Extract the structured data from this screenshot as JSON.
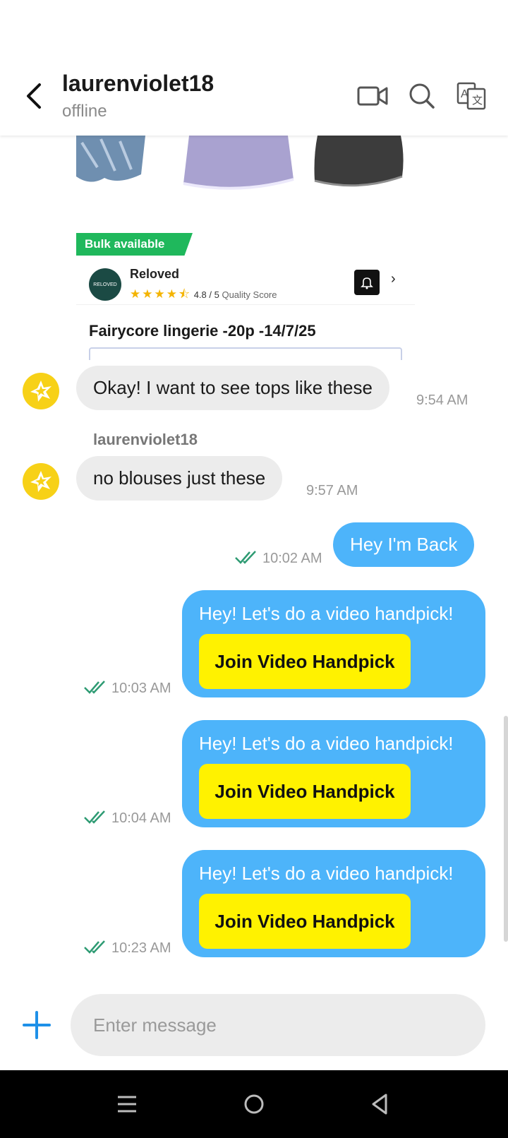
{
  "header": {
    "contact_name": "laurenviolet18",
    "status": "offline",
    "icons": [
      "back-arrow-icon",
      "video-call-icon",
      "search-icon",
      "translate-icon"
    ]
  },
  "product_card": {
    "bulk_tag": "Bulk available",
    "seller_name": "Reloved",
    "seller_logo_text": "RELOVED",
    "rating": "4.8 / 5",
    "rating_label": "Quality Score",
    "title": "Fairycore lingerie -20p -14/7/25"
  },
  "messages": {
    "m1_text": "Okay! I want to see tops like these",
    "m1_time": "9:54 AM",
    "m2_sender": "laurenviolet18",
    "m2_text": "no blouses just these",
    "m2_time": "9:57 AM",
    "m3_text": "Hey I'm Back",
    "m3_time": "10:02 AM",
    "handpick_text": "Hey! Let's do a video handpick!",
    "handpick_button": "Join Video Handpick",
    "h1_time": "10:03 AM",
    "h2_time": "10:04 AM",
    "h3_time": "10:23 AM"
  },
  "composer": {
    "placeholder": "Enter message"
  },
  "colors": {
    "outgoing_bubble": "#4db4fa",
    "incoming_bubble": "#ececec",
    "handpick_button": "#fff200",
    "read_check": "#2e9b73",
    "avatar": "#f7d117",
    "bulk_tag": "#1fb85c"
  }
}
